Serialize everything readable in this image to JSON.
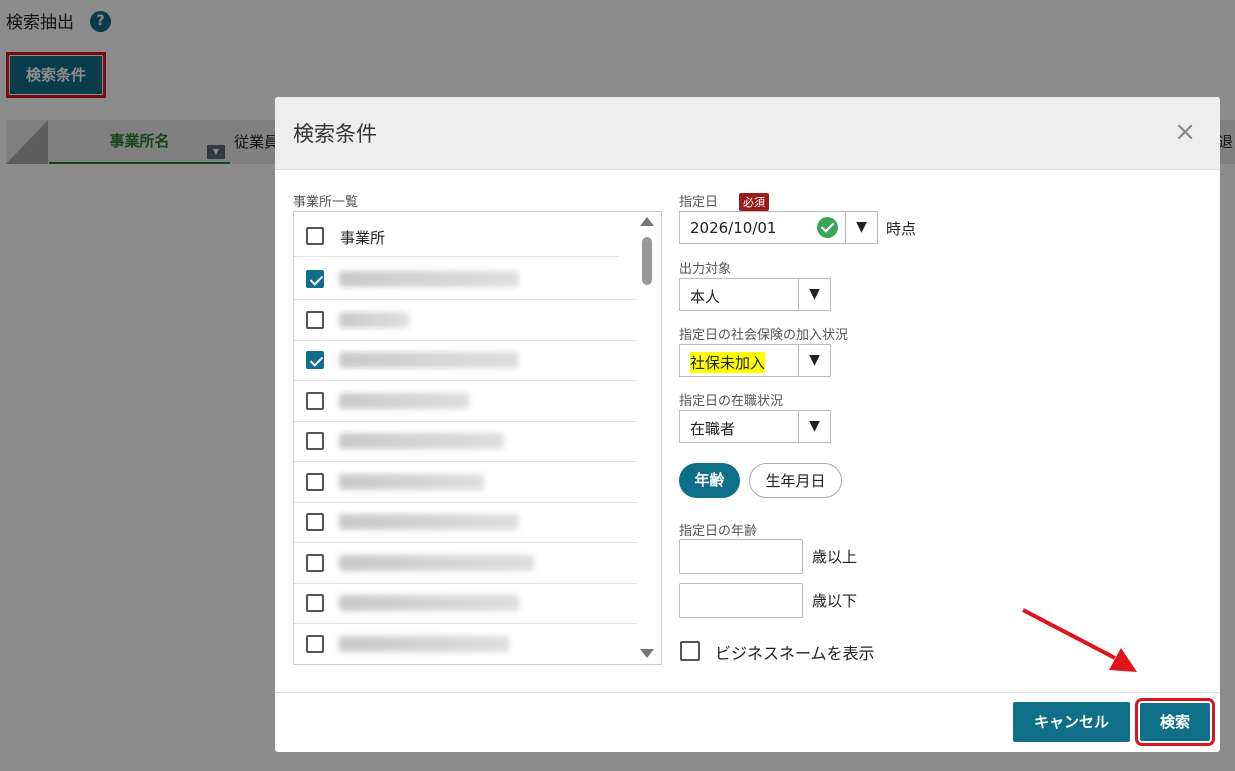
{
  "page": {
    "title": "検索抽出",
    "help_icon": "?",
    "search_conditions_button": "検索条件"
  },
  "grid": {
    "columns": [
      "事業所名",
      "従業員",
      "退"
    ]
  },
  "dialog": {
    "title": "検索条件",
    "close_icon": "×",
    "office_list": {
      "label": "事業所一覧",
      "header_label": "事業所",
      "header_checked": false,
      "rows": [
        {
          "checked": true
        },
        {
          "checked": false
        },
        {
          "checked": true
        },
        {
          "checked": false
        },
        {
          "checked": false
        },
        {
          "checked": false
        },
        {
          "checked": false
        },
        {
          "checked": false
        },
        {
          "checked": false
        },
        {
          "checked": false
        }
      ]
    },
    "designated_date": {
      "label": "指定日",
      "required_badge": "必須",
      "value": "2026/10/01",
      "suffix": "時点"
    },
    "output_target": {
      "label": "出力対象",
      "value": "本人"
    },
    "social_insurance": {
      "label": "指定日の社会保険の加入状況",
      "value": "社保未加入"
    },
    "employment_status": {
      "label": "指定日の在職状況",
      "value": "在職者"
    },
    "age_toggle": {
      "age": "年齢",
      "birthdate": "生年月日",
      "selected": "年齢"
    },
    "age": {
      "label": "指定日の年齢",
      "min_value": "",
      "min_unit": "歳以上",
      "max_value": "",
      "max_unit": "歳以下"
    },
    "business_name": {
      "label": "ビジネスネームを表示",
      "checked": false
    },
    "buttons": {
      "cancel": "キャンセル",
      "search": "検索"
    }
  },
  "colors": {
    "primary": "#0f6e88",
    "highlight_outline": "#d8161f",
    "required": "#9b1b1b",
    "valid": "#3aa757"
  }
}
